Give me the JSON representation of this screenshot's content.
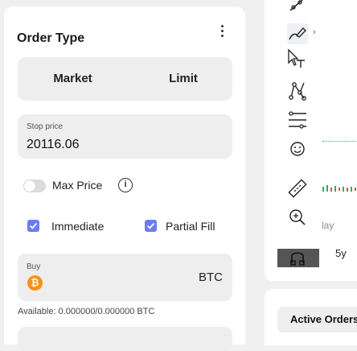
{
  "order_panel": {
    "title": "Order Type",
    "menu_icon": "kebab-menu-icon",
    "order_types": [
      {
        "label": "Market"
      },
      {
        "label": "Limit"
      }
    ],
    "stop_price": {
      "label": "Stop price",
      "value": "20116.06"
    },
    "max_price": {
      "label": "Max Price",
      "enabled": false,
      "info_icon": "info-icon"
    },
    "checkboxes": [
      {
        "label": "Immediate",
        "checked": true
      },
      {
        "label": "Partial Fill",
        "checked": true
      }
    ],
    "buy": {
      "label": "Buy",
      "coin_icon": "bitcoin-icon",
      "coin_symbol": "₿",
      "currency": "BTC"
    },
    "available": "Available: 0.000000/0.000000 BTC"
  },
  "chart_toolbar": {
    "tools": [
      {
        "icon": "trend-line-icon"
      },
      {
        "icon": "brush-icon",
        "active": true
      },
      {
        "icon": "cursor-text-icon"
      },
      {
        "icon": "pattern-icon"
      },
      {
        "icon": "fib-levels-icon"
      },
      {
        "icon": "smiley-icon"
      },
      {
        "icon": "ruler-icon"
      },
      {
        "icon": "zoom-in-icon"
      },
      {
        "icon": "magnet-icon"
      }
    ],
    "more_arrow": "›",
    "partial_day_label": "lay",
    "partial_range_label": "5y"
  },
  "bottom_tabs": {
    "active_orders_label": "Active Orders"
  },
  "colors": {
    "accent_checkbox": "#6b7cf0",
    "bitcoin": "#f7931a",
    "panel_bg": "#ffffff",
    "page_bg": "#f0f0f0",
    "field_bg": "#eeeeee"
  }
}
